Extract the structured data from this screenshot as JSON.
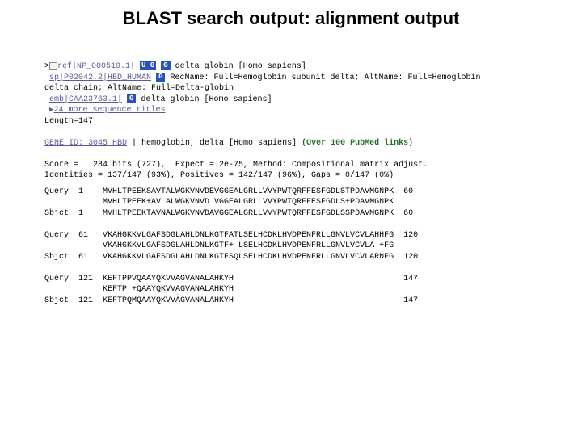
{
  "title": "BLAST search output: alignment output",
  "hits": [
    {
      "prefix": ">",
      "acc": "ref|NP_000510.1|",
      "badges": [
        "UG",
        "G"
      ],
      "desc": " delta globin [Homo sapiens]"
    },
    {
      "prefix": "",
      "acc": "sp|P02042.2|HBD_HUMAN",
      "badges": [
        "G"
      ],
      "desc": " RecName: Full=Hemoglobin subunit delta; AltName: Full=Hemoglobin"
    }
  ],
  "wrap_line": "delta chain; AltName: Full=Delta-globin",
  "hit3": {
    "acc": "emb|CAA23763.1|",
    "badges": [
      "G"
    ],
    "desc": " delta globin [Homo sapiens]"
  },
  "more_link": "24 more sequence titles",
  "length_line": "Length=147",
  "gene_link": "GENE ID: 3045 HBD",
  "gene_desc": " | hemoglobin, delta [Homo sapiens] ",
  "pubmed": "(Over 100 PubMed links)",
  "stats_line1": "Score =   284 bits (727),  Expect = 2e-75, Method: Compositional matrix adjust.",
  "stats_line2": "Identities = 137/147 (93%), Positives = 142/147 (96%), Gaps = 0/147 (0%)",
  "alignment": [
    {
      "label": "Query  1",
      "seq": "MVHLTPEEKSAVTALWGKVNVDEVGGEALGRLLVVYPWTQRFFESFGDLSTPDAVMGNPK",
      "end": "60"
    },
    {
      "label": "",
      "seq": "MVHLTPEEK+AV ALWGKVNVD VGGEALGRLLVVYPWTQRFFESFGDLS+PDAVMGNPK",
      "end": ""
    },
    {
      "label": "Sbjct  1",
      "seq": "MVHLTPEEKTAVNALWGKVNVDAVGGEALGRLLVVYPWTQRFFESFGDLSSPDAVMGNPK",
      "end": "60"
    },
    {
      "label": "",
      "seq": "",
      "end": ""
    },
    {
      "label": "Query  61",
      "seq": "VKAHGKKVLGAFSDGLAHLDNLKGTFATLSELHCDKLHVDPENFRLLGNVLVCVLAHHFG",
      "end": "120"
    },
    {
      "label": "",
      "seq": "VKAHGKKVLGAFSDGLAHLDNLKGTF+ LSELHCDKLHVDPENFRLLGNVLVCVLA +FG",
      "end": ""
    },
    {
      "label": "Sbjct  61",
      "seq": "VKAHGKKVLGAFSDGLAHLDNLKGTFSQLSELHCDKLHVDPENFRLLGNVLVCVLARNFG",
      "end": "120"
    },
    {
      "label": "",
      "seq": "",
      "end": ""
    },
    {
      "label": "Query  121",
      "seq": "KEFTPPVQAAYQKVVAGVANALAHKYH",
      "end": "147"
    },
    {
      "label": "",
      "seq": "KEFTP +QAAYQKVVAGVANALAHKYH",
      "end": ""
    },
    {
      "label": "Sbjct  121",
      "seq": "KEFTPQMQAAYQKVVAGVANALAHKYH",
      "end": "147"
    }
  ]
}
